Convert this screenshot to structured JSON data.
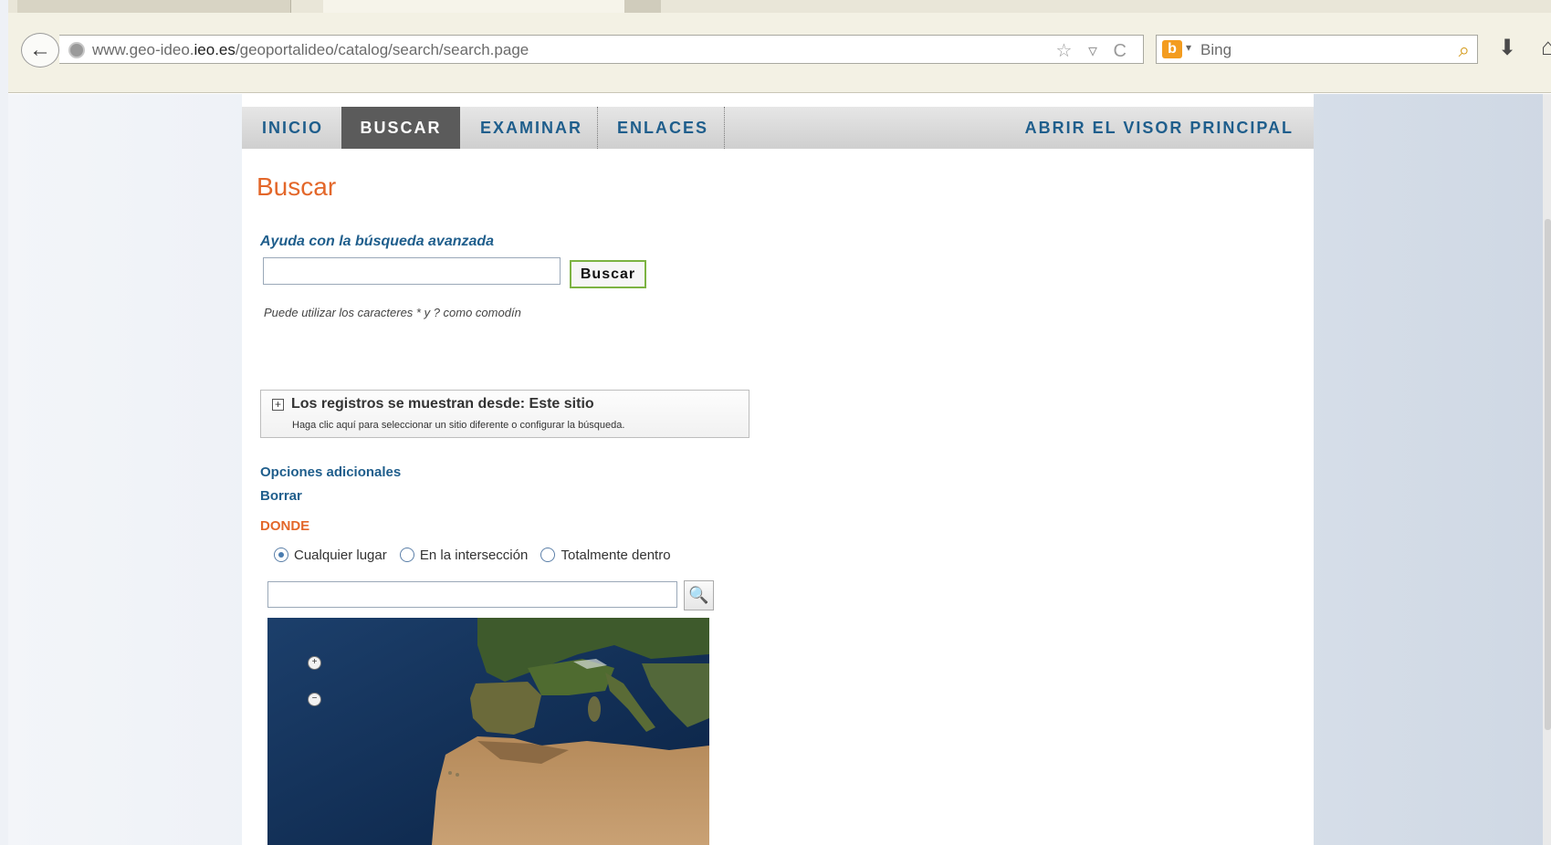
{
  "browser": {
    "url_prefix": "www.geo-ideo.",
    "url_domain": "ieo.es",
    "url_path": "/geoportalideo/catalog/search/search.page",
    "url_icons": "☆ ▿ C",
    "search_engine": "Bing",
    "icons": [
      "back-arrow-icon",
      "globe-icon",
      "bookmark-star-icon",
      "reload-icon",
      "bing-logo",
      "magnifier-icon",
      "download-icon",
      "home-icon"
    ]
  },
  "nav": {
    "items": [
      {
        "label": "INICIO",
        "active": false
      },
      {
        "label": "BUSCAR",
        "active": true
      },
      {
        "label": "EXAMINAR",
        "active": false
      },
      {
        "label": "ENLACES",
        "active": false
      }
    ],
    "right_link": "ABRIR EL VISOR PRINCIPAL"
  },
  "page": {
    "title": "Buscar",
    "help_link": "Ayuda con la búsqueda avanzada",
    "search_value": "",
    "search_button": "Buscar",
    "hint": "Puede utilizar los caracteres * y ? como comodín"
  },
  "sites": {
    "title": "Los registros se muestran desde: Este sitio",
    "subtitle": "Haga clic aquí para seleccionar un sitio diferente o configurar la búsqueda."
  },
  "options": {
    "additional": "Opciones adicionales",
    "clear": "Borrar",
    "where": "DONDE",
    "radios": [
      {
        "label": "Cualquier lugar",
        "checked": true
      },
      {
        "label": "En la intersección",
        "checked": false
      },
      {
        "label": "Totalmente dentro",
        "checked": false
      }
    ],
    "place_value": ""
  },
  "colors": {
    "accent_orange": "#e3672a",
    "link_blue": "#1f5e8c",
    "nav_active_bg": "#5b5b5b",
    "button_border_green": "#7cb342"
  }
}
